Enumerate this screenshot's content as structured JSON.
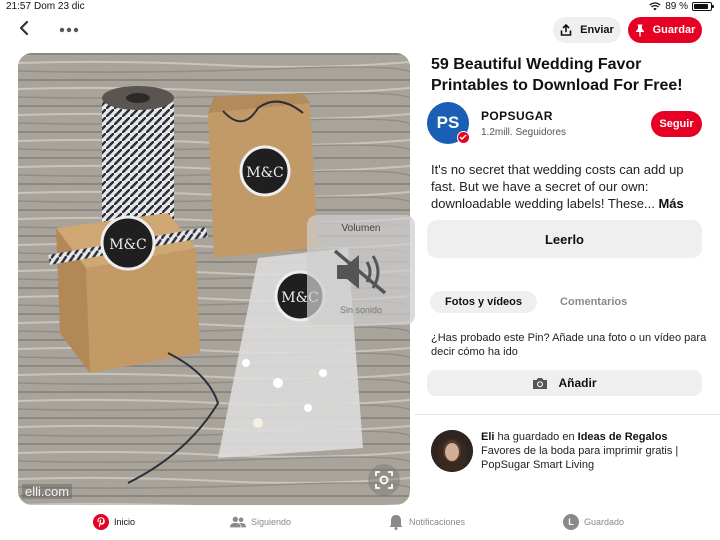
{
  "status_bar": {
    "time": "21:57",
    "date": "Dom 23 dic",
    "battery": "89 %",
    "battery_level": 0.89
  },
  "toolbar": {
    "send_label": "Enviar",
    "save_label": "Guardar"
  },
  "pin": {
    "title": "59 Beautiful Wedding Favor Printables to Download For Free!",
    "watermark": "elli.com"
  },
  "volume_hud": {
    "title": "Volumen",
    "subtitle": "Sin sonido"
  },
  "profile": {
    "initials": "PS",
    "name": "POPSUGAR",
    "followers": "1.2mill. Seguidores",
    "follow_label": "Seguir"
  },
  "description": {
    "text": "It's no secret that wedding costs can add up fast. But we have a secret of our own: downloadable wedding labels! These...",
    "more": "Más"
  },
  "read_label": "Leerlo",
  "tabs": [
    {
      "label": "Fotos y vídeos",
      "active": true
    },
    {
      "label": "Comentarios",
      "active": false
    }
  ],
  "tried": {
    "prompt": "¿Has probado este Pin? Añade una foto o un vídeo para decir cómo ha ido",
    "add_label": "Añadir"
  },
  "activity": {
    "user": "Eli",
    "action": "ha guardado en",
    "board": "Ideas de Regalos",
    "caption": "Favores de la boda para imprimir gratis | PopSugar Smart Living"
  },
  "bottom_nav": {
    "items": [
      {
        "label": "Inicio",
        "icon": "pinterest-logo-icon",
        "active": true
      },
      {
        "label": "Siguiendo",
        "icon": "people-icon",
        "active": false
      },
      {
        "label": "Notificaciones",
        "icon": "bell-icon",
        "active": false
      },
      {
        "label": "Guardado",
        "icon": "profile-avatar-icon",
        "active": false,
        "avatar_letter": "L"
      }
    ]
  },
  "colors": {
    "brand_red": "#e60023",
    "popsugar_blue": "#1a5fb4",
    "button_gray": "#efefef"
  }
}
